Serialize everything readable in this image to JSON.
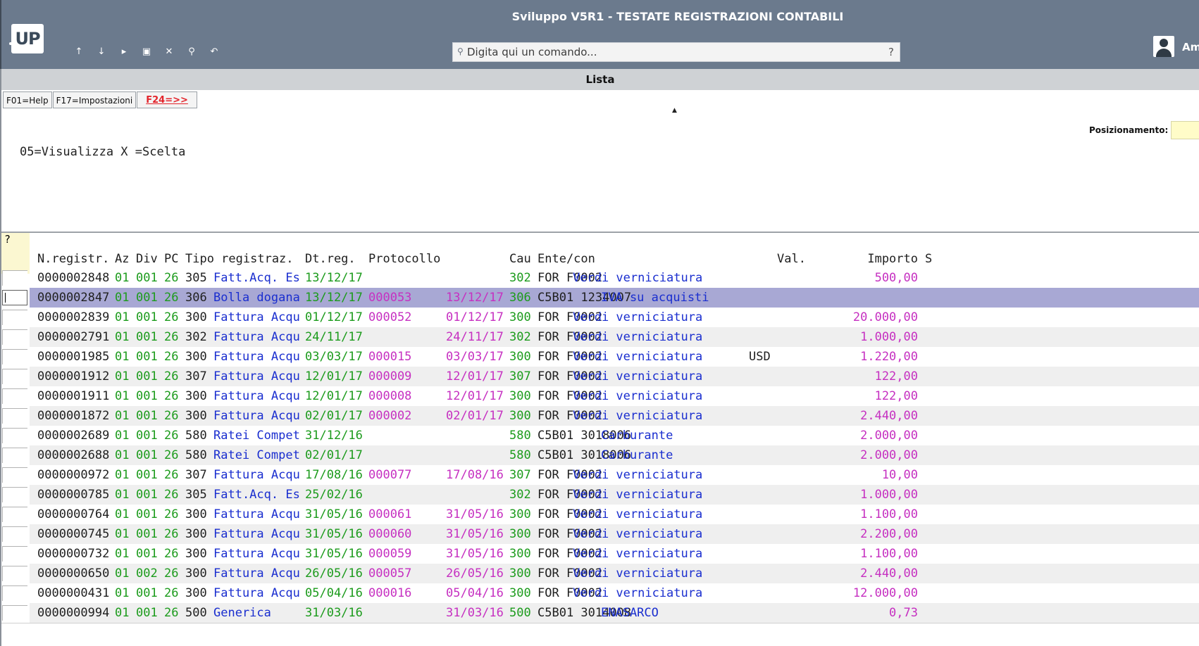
{
  "window": {
    "title": "Sviluppo V5R1 - TESTATE REGISTRAZIONI CONTABILI"
  },
  "logo": {
    "text": "UP"
  },
  "toolbar": {
    "icons": [
      {
        "name": "arrow-up-icon",
        "glyph": "↑"
      },
      {
        "name": "arrow-down-icon",
        "glyph": "↓"
      },
      {
        "name": "play-icon",
        "glyph": "▸"
      },
      {
        "name": "terminal-icon",
        "glyph": "▣"
      },
      {
        "name": "close-icon",
        "glyph": "✕"
      },
      {
        "name": "search-icon",
        "glyph": "⚲"
      },
      {
        "name": "undo-icon",
        "glyph": "↶"
      }
    ]
  },
  "command": {
    "placeholder": "Digita qui un comando...",
    "help": "?"
  },
  "user": {
    "name": "Am"
  },
  "panel": {
    "title": "Lista"
  },
  "fkeys": {
    "help": "F01=Help",
    "settings": "F17=Impostazioni",
    "more": "F24=>>"
  },
  "positioning": {
    "label": "Posizionamento:",
    "value": ""
  },
  "options": {
    "text": "05=Visualizza X =Scelta"
  },
  "list": {
    "selector_header": "?",
    "headers": {
      "nreg": "N.registr.",
      "az": "Az",
      "div": "Div",
      "pc": "PC",
      "tipo": "Tipo registraz.",
      "dtreg": "Dt.reg.",
      "prot": "Protocollo",
      "cau": "Cau",
      "ente": "Ente/con",
      "val": "Val.",
      "importo": "Importo",
      "s": "S"
    },
    "rows": [
      {
        "nreg": "0000002848",
        "az": "01",
        "div": "001",
        "pc": "26",
        "tcode": "305",
        "tdesc": "Fatt.Acq. Es",
        "dtreg": "13/12/17",
        "prot": "",
        "pdate": "",
        "cau": "302",
        "ente": "FOR F0002",
        "desc": "Verdi verniciatura",
        "val": "",
        "importo": "500,00"
      },
      {
        "nreg": "0000002847",
        "az": "01",
        "div": "001",
        "pc": "26",
        "tcode": "306",
        "tdesc": "Bolla dogana",
        "dtreg": "13/12/17",
        "prot": "000053",
        "pdate": "13/12/17",
        "cau": "306",
        "ente": "C5B01 1234007",
        "desc": "IVA su acquisti",
        "val": "",
        "importo": "",
        "selected": true
      },
      {
        "nreg": "0000002839",
        "az": "01",
        "div": "001",
        "pc": "26",
        "tcode": "300",
        "tdesc": "Fattura Acqu",
        "dtreg": "01/12/17",
        "prot": "000052",
        "pdate": "01/12/17",
        "cau": "300",
        "ente": "FOR F0002",
        "desc": "Verdi verniciatura",
        "val": "",
        "importo": "20.000,00"
      },
      {
        "nreg": "0000002791",
        "az": "01",
        "div": "001",
        "pc": "26",
        "tcode": "302",
        "tdesc": "Fattura Acqu",
        "dtreg": "24/11/17",
        "prot": "",
        "pdate": "24/11/17",
        "cau": "302",
        "ente": "FOR F0002",
        "desc": "Verdi verniciatura",
        "val": "",
        "importo": "1.000,00"
      },
      {
        "nreg": "0000001985",
        "az": "01",
        "div": "001",
        "pc": "26",
        "tcode": "300",
        "tdesc": "Fattura Acqu",
        "dtreg": "03/03/17",
        "prot": "000015",
        "pdate": "03/03/17",
        "cau": "300",
        "ente": "FOR F0002",
        "desc": "Verdi verniciatura",
        "val": "USD",
        "importo": "1.220,00"
      },
      {
        "nreg": "0000001912",
        "az": "01",
        "div": "001",
        "pc": "26",
        "tcode": "307",
        "tdesc": "Fattura Acqu",
        "dtreg": "12/01/17",
        "prot": "000009",
        "pdate": "12/01/17",
        "cau": "307",
        "ente": "FOR F0002",
        "desc": "Verdi verniciatura",
        "val": "",
        "importo": "122,00"
      },
      {
        "nreg": "0000001911",
        "az": "01",
        "div": "001",
        "pc": "26",
        "tcode": "300",
        "tdesc": "Fattura Acqu",
        "dtreg": "12/01/17",
        "prot": "000008",
        "pdate": "12/01/17",
        "cau": "300",
        "ente": "FOR F0002",
        "desc": "Verdi verniciatura",
        "val": "",
        "importo": "122,00"
      },
      {
        "nreg": "0000001872",
        "az": "01",
        "div": "001",
        "pc": "26",
        "tcode": "300",
        "tdesc": "Fattura Acqu",
        "dtreg": "02/01/17",
        "prot": "000002",
        "pdate": "02/01/17",
        "cau": "300",
        "ente": "FOR F0002",
        "desc": "Verdi verniciatura",
        "val": "",
        "importo": "2.440,00"
      },
      {
        "nreg": "0000002689",
        "az": "01",
        "div": "001",
        "pc": "26",
        "tcode": "580",
        "tdesc": "Ratei Compet",
        "dtreg": "31/12/16",
        "prot": "",
        "pdate": "",
        "cau": "580",
        "ente": "C5B01 3018006",
        "desc": "Carburante",
        "val": "",
        "importo": "2.000,00"
      },
      {
        "nreg": "0000002688",
        "az": "01",
        "div": "001",
        "pc": "26",
        "tcode": "580",
        "tdesc": "Ratei Compet",
        "dtreg": "02/01/17",
        "prot": "",
        "pdate": "",
        "cau": "580",
        "ente": "C5B01 3018006",
        "desc": "Carburante",
        "val": "",
        "importo": "2.000,00"
      },
      {
        "nreg": "0000000972",
        "az": "01",
        "div": "001",
        "pc": "26",
        "tcode": "307",
        "tdesc": "Fattura Acqu",
        "dtreg": "17/08/16",
        "prot": "000077",
        "pdate": "17/08/16",
        "cau": "307",
        "ente": "FOR F0002",
        "desc": "Verdi verniciatura",
        "val": "",
        "importo": "10,00"
      },
      {
        "nreg": "0000000785",
        "az": "01",
        "div": "001",
        "pc": "26",
        "tcode": "305",
        "tdesc": "Fatt.Acq. Es",
        "dtreg": "25/02/16",
        "prot": "",
        "pdate": "",
        "cau": "302",
        "ente": "FOR F0002",
        "desc": "Verdi verniciatura",
        "val": "",
        "importo": "1.000,00"
      },
      {
        "nreg": "0000000764",
        "az": "01",
        "div": "001",
        "pc": "26",
        "tcode": "300",
        "tdesc": "Fattura Acqu",
        "dtreg": "31/05/16",
        "prot": "000061",
        "pdate": "31/05/16",
        "cau": "300",
        "ente": "FOR F0002",
        "desc": "Verdi verniciatura",
        "val": "",
        "importo": "1.100,00"
      },
      {
        "nreg": "0000000745",
        "az": "01",
        "div": "001",
        "pc": "26",
        "tcode": "300",
        "tdesc": "Fattura Acqu",
        "dtreg": "31/05/16",
        "prot": "000060",
        "pdate": "31/05/16",
        "cau": "300",
        "ente": "FOR F0002",
        "desc": "Verdi verniciatura",
        "val": "",
        "importo": "2.200,00"
      },
      {
        "nreg": "0000000732",
        "az": "01",
        "div": "001",
        "pc": "26",
        "tcode": "300",
        "tdesc": "Fattura Acqu",
        "dtreg": "31/05/16",
        "prot": "000059",
        "pdate": "31/05/16",
        "cau": "300",
        "ente": "FOR F0002",
        "desc": "Verdi verniciatura",
        "val": "",
        "importo": "1.100,00"
      },
      {
        "nreg": "0000000650",
        "az": "01",
        "div": "002",
        "pc": "26",
        "tcode": "300",
        "tdesc": "Fattura Acqu",
        "dtreg": "26/05/16",
        "prot": "000057",
        "pdate": "26/05/16",
        "cau": "300",
        "ente": "FOR F0002",
        "desc": "Verdi verniciatura",
        "val": "",
        "importo": "2.440,00"
      },
      {
        "nreg": "0000000431",
        "az": "01",
        "div": "001",
        "pc": "26",
        "tcode": "300",
        "tdesc": "Fattura Acqu",
        "dtreg": "05/04/16",
        "prot": "000016",
        "pdate": "05/04/16",
        "cau": "300",
        "ente": "FOR F0002",
        "desc": "Verdi verniciatura",
        "val": "",
        "importo": "12.000,00"
      },
      {
        "nreg": "0000000994",
        "az": "01",
        "div": "001",
        "pc": "26",
        "tcode": "500",
        "tdesc": "Generica",
        "dtreg": "31/03/16",
        "prot": "",
        "pdate": "31/03/16",
        "cau": "500",
        "ente": "C5B01 3014008",
        "desc": "ENASARCO",
        "val": "",
        "importo": "0,73"
      }
    ]
  },
  "colors": {
    "titlebar": "#6b7a8d",
    "selected_row": "#a8a8d4",
    "alt_row": "#efefef",
    "green": "#1c9b1c",
    "blue": "#1a2ecf",
    "magenta": "#c630c1",
    "fkey_more": "#e3242b"
  }
}
